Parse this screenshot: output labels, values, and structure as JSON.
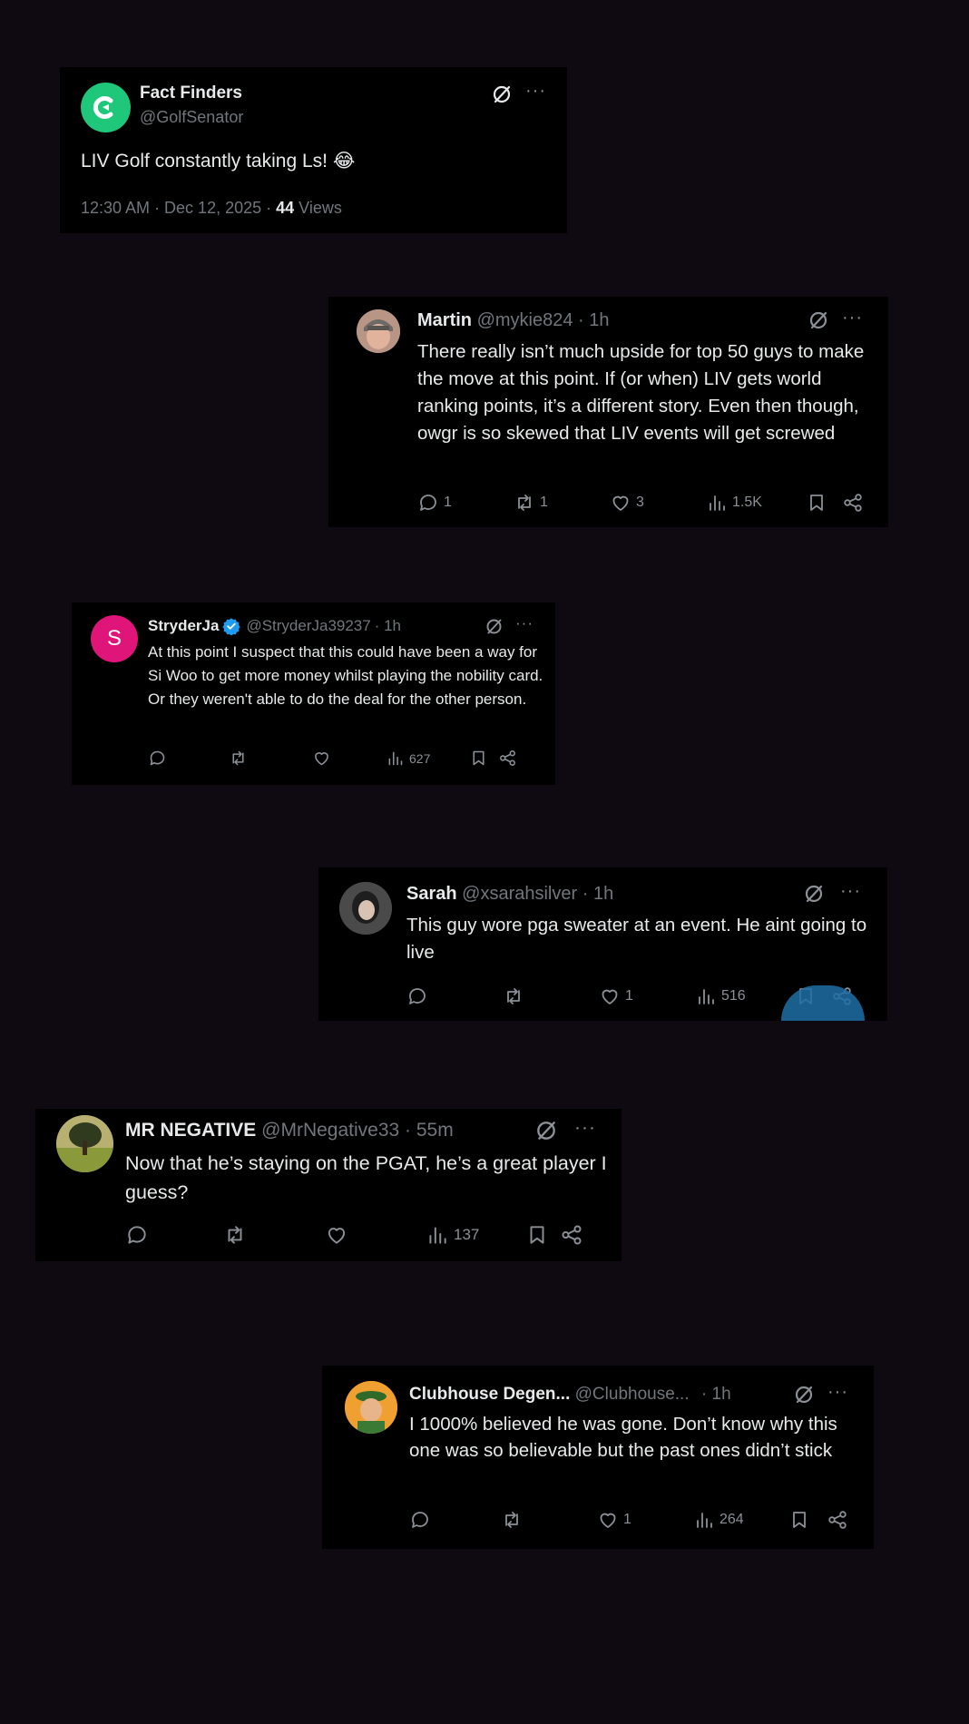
{
  "main_post": {
    "display_name": "Fact Finders",
    "handle": "@GolfSenator",
    "text": "LIV Golf constantly taking Ls!",
    "emoji": "😂",
    "timestamp": "12:30 AM · Dec 12, 2025 · ",
    "views_count": "44",
    "views_label": " Views",
    "avatar_color": "#1ec77a"
  },
  "replies": [
    {
      "display_name": "Martin",
      "handle": "@mykie824",
      "time": "· 1h",
      "text": "There really isn’t much upside for top 50 guys to make the move at this point. If (or when) LIV gets world ranking points, it’s a different story. Even then though, owgr is so skewed that LIV events will get screwed",
      "replies_count": "1",
      "reposts_count": "1",
      "likes_count": "3",
      "views_count": "1.5K"
    },
    {
      "display_name": "StryderJa",
      "handle": "@StryderJa39237",
      "time": "· 1h",
      "verified": true,
      "avatar_letter": "S",
      "avatar_color": "#e0157a",
      "text": "At this point I suspect that this could have been a way for Si Woo to get more money whilst playing the nobility card. Or they weren't able to do the deal for the other person.",
      "replies_count": "",
      "reposts_count": "",
      "likes_count": "",
      "views_count": "627"
    },
    {
      "display_name": "Sarah",
      "handle": "@xsarahsilver",
      "time": "· 1h",
      "text": "This guy wore pga sweater at an event. He aint going to live",
      "replies_count": "",
      "reposts_count": "",
      "likes_count": "1",
      "views_count": "516"
    },
    {
      "display_name": "MR NEGATIVE",
      "handle": "@MrNegative33",
      "time": "· 55m",
      "text": "Now that he’s staying on the PGAT, he’s a great player I guess?",
      "replies_count": "",
      "reposts_count": "",
      "likes_count": "",
      "views_count": "137"
    },
    {
      "display_name": "Clubhouse Degen...",
      "handle": "@Clubhouse...",
      "time": "· 1h",
      "text": "I 1000% believed he was gone. Don’t know why this one was so believable but the past ones didn’t stick",
      "replies_count": "",
      "reposts_count": "",
      "likes_count": "1",
      "views_count": "264"
    }
  ],
  "more_label": "···",
  "colors": {
    "background": "#0f0a11",
    "card": "#000000",
    "text": "#e7e9ea",
    "muted": "#71767b",
    "verified": "#1d9bf0"
  }
}
